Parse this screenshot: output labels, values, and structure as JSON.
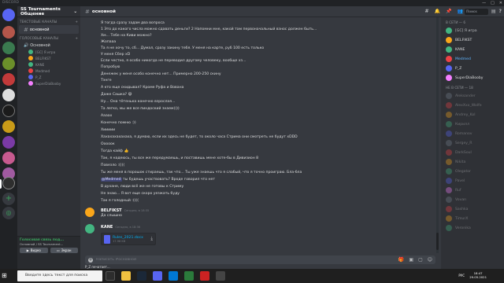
{
  "window": {
    "title": "DISCORD",
    "controls": [
      "—",
      "□",
      "✕"
    ]
  },
  "server": {
    "name": "SS Tournaments Общение",
    "categories": [
      {
        "label": "Текстовые каналы",
        "channels": [
          {
            "label": "основной",
            "active": true
          }
        ]
      },
      {
        "label": "Голосовые каналы",
        "channels": [
          {
            "label": "Основной",
            "users": [
              "[GC] Я игра",
              "BELFIKST",
              "KANE",
              "Medmed",
              "P_Z",
              "SuperDiaBooby"
            ]
          }
        ]
      }
    ]
  },
  "voice": {
    "status": "Голосовая связь под...",
    "sub": "Основной / SS Tournament...",
    "video_label": "Видео",
    "screen_label": "Экран"
  },
  "header": {
    "channel": "основной",
    "search_placeholder": "Поиск"
  },
  "messages": {
    "lines": [
      "Я тогда сразу задам два вопроса",
      "1 Это до какого числа можно сдавать деньги? 2 Напомни мне, какой там первоначальный взнос должен быть...",
      "Хм... Тебе на Киви можно?",
      "Жопааа",
      "Та я не хочу то, сб... Думал, сразу закину тебя. У меня на карте, руб 100 есть только",
      "У меня Сбер xD",
      "Если честно, я особо никогда не переводил другому человеку, вообще хз...",
      "Попробую",
      "Денежек у меня особо конечно нет... Примерно 200-250 скину",
      "Тэнге",
      "А кто еще скидывал? Кроме Руфа и Вована",
      "Даже Сашка? 😄",
      "Ну... Она тётенька конечно взрослая...",
      "Та легко, мы же все пиндоский знаем))))",
      "Аааах",
      "Конечно помню :))",
      "Хиииии",
      "Хахахахахахаха, я думаю, если их здесь не будет, то около часа Стрима они смотреть не будут xDDD",
      "Ооооок",
      "Тогда кайф 👍",
      "Так, я надеюсь, ты все же передумаешь, и поставишь мене хоте-бы в Дивизион 8",
      "Повезло :((((",
      "Ты же меня в порошок стираешь, так что... Ты уже знаешь что я слабый, что я точно проиграю. Бла-бла",
      "ты будешь участвовать? Вроде говорил что нет",
      "В духане, люди всё же не готовы к Стриму",
      "Не знаю... Я вот еще скоро уезжать буду",
      "Так я голодный :(((("
    ],
    "mention": "@Medmed",
    "belfikst": {
      "author": "BELFIKST",
      "time": "Сегодня, в 18:35",
      "text": "Да слышно"
    },
    "kane": {
      "author": "KANE",
      "time": "Сегодня, в 18:36",
      "file_name": "Rules_2021.docx",
      "file_size": "17.98 KB"
    }
  },
  "composer": {
    "placeholder": "Написать #основной",
    "typing": "P_Z печатает..."
  },
  "members": {
    "online_label": "В СЕТИ — 6",
    "online": [
      {
        "name": "[GC] Я игра",
        "color": "#b9bbbe",
        "avatar": "#43b581"
      },
      {
        "name": "BELFIKST",
        "color": "#dcddde",
        "avatar": "#faa61a"
      },
      {
        "name": "KANE",
        "color": "#dcddde",
        "avatar": "#43b581"
      },
      {
        "name": "Medmed",
        "color": "#5fb5ff",
        "avatar": "#ed4245"
      },
      {
        "name": "P_Z",
        "color": "#dcddde",
        "avatar": "#5865f2"
      },
      {
        "name": "SuperDiaBooby",
        "color": "#dcddde",
        "avatar": "#f47fff"
      }
    ],
    "offline_label": "НЕ В СЕТИ — 18",
    "offline": [
      {
        "name": "Aleksander",
        "avatar": "#747f8d"
      },
      {
        "name": "AlexXxx_Wolfe",
        "avatar": "#ed4245"
      },
      {
        "name": "Andrey_Kol",
        "avatar": "#faa61a"
      },
      {
        "name": "Кирилл",
        "avatar": "#43b581"
      },
      {
        "name": "Romanov",
        "avatar": "#5865f2"
      },
      {
        "name": "Sergey_R",
        "avatar": "#747f8d"
      },
      {
        "name": "DarkSoul",
        "avatar": "#ed4245"
      },
      {
        "name": "Nikita",
        "avatar": "#faa61a"
      },
      {
        "name": "Olegator",
        "avatar": "#43b581"
      },
      {
        "name": "Pavel",
        "avatar": "#5865f2"
      },
      {
        "name": "Ruf",
        "avatar": "#f47fff"
      },
      {
        "name": "Vovan",
        "avatar": "#747f8d"
      },
      {
        "name": "Sashka",
        "avatar": "#ed4245"
      },
      {
        "name": "TimurX",
        "avatar": "#faa61a"
      },
      {
        "name": "Veronika",
        "avatar": "#43b581"
      }
    ]
  },
  "user": {
    "name": "Кирилл1092"
  },
  "taskbar": {
    "search_placeholder": "Введите здесь текст для поиска",
    "lang": "РУС",
    "time": "18:47",
    "date": "29.05.2021"
  }
}
